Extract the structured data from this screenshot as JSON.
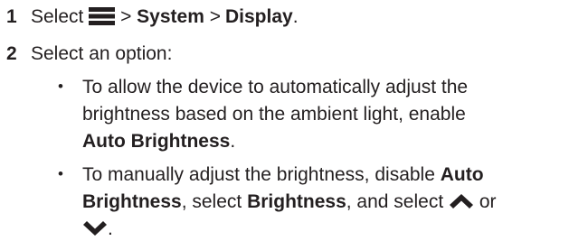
{
  "steps": [
    {
      "number": "1",
      "text_before": "Select",
      "menu_icon": "menu-hamburger-icon",
      "sep1": ">",
      "system": "System",
      "sep2": ">",
      "display": "Display",
      "end": "."
    },
    {
      "number": "2",
      "text": "Select an option:",
      "bullets": [
        {
          "bullet": "•",
          "line1": "To allow the device to automatically adjust the",
          "line2": "brightness based on the ambient light, enable",
          "bold": "Auto Brightness",
          "end": "."
        },
        {
          "bullet": "•",
          "line1_text": "To manually adjust the brightness, disable",
          "auto": "Auto",
          "brightness_word": "Brightness",
          "mid1": ", select",
          "brightness_bold": "Brightness",
          "mid2": ", and select",
          "up_icon": "chevron-up-icon",
          "or": "or",
          "down_icon": "chevron-down-icon",
          "end": "."
        }
      ]
    }
  ]
}
